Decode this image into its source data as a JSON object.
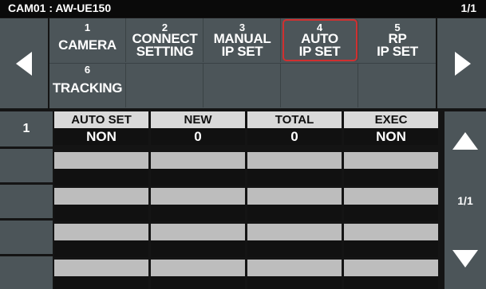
{
  "header": {
    "camera_label": "CAM01 : AW-UE150",
    "page_indicator": "1/1"
  },
  "menu": {
    "items": [
      {
        "number": "1",
        "label": "CAMERA"
      },
      {
        "number": "2",
        "label_line1": "CONNECT",
        "label_line2": "SETTING"
      },
      {
        "number": "3",
        "label_line1": "MANUAL",
        "label_line2": "IP SET"
      },
      {
        "number": "4",
        "label_line1": "AUTO",
        "label_line2": "IP SET",
        "selected": true
      },
      {
        "number": "5",
        "label_line1": "RP",
        "label_line2": "IP SET"
      },
      {
        "number": "6",
        "label": "TRACKING"
      }
    ]
  },
  "table": {
    "rows": [
      {
        "index": "1",
        "cells": [
          {
            "header": "AUTO SET",
            "value": "NON"
          },
          {
            "header": "NEW",
            "value": "0"
          },
          {
            "header": "TOTAL",
            "value": "0"
          },
          {
            "header": "EXEC",
            "value": "NON"
          }
        ]
      },
      {
        "index": ""
      },
      {
        "index": ""
      },
      {
        "index": ""
      },
      {
        "index": ""
      }
    ]
  },
  "pager": {
    "page": "1/1"
  },
  "icons": {
    "left": "left-triangle-icon",
    "right": "right-triangle-icon",
    "up": "up-triangle-icon",
    "down": "down-triangle-icon"
  },
  "colors": {
    "selected_outline": "#d03030",
    "panel": "#4c5559"
  }
}
